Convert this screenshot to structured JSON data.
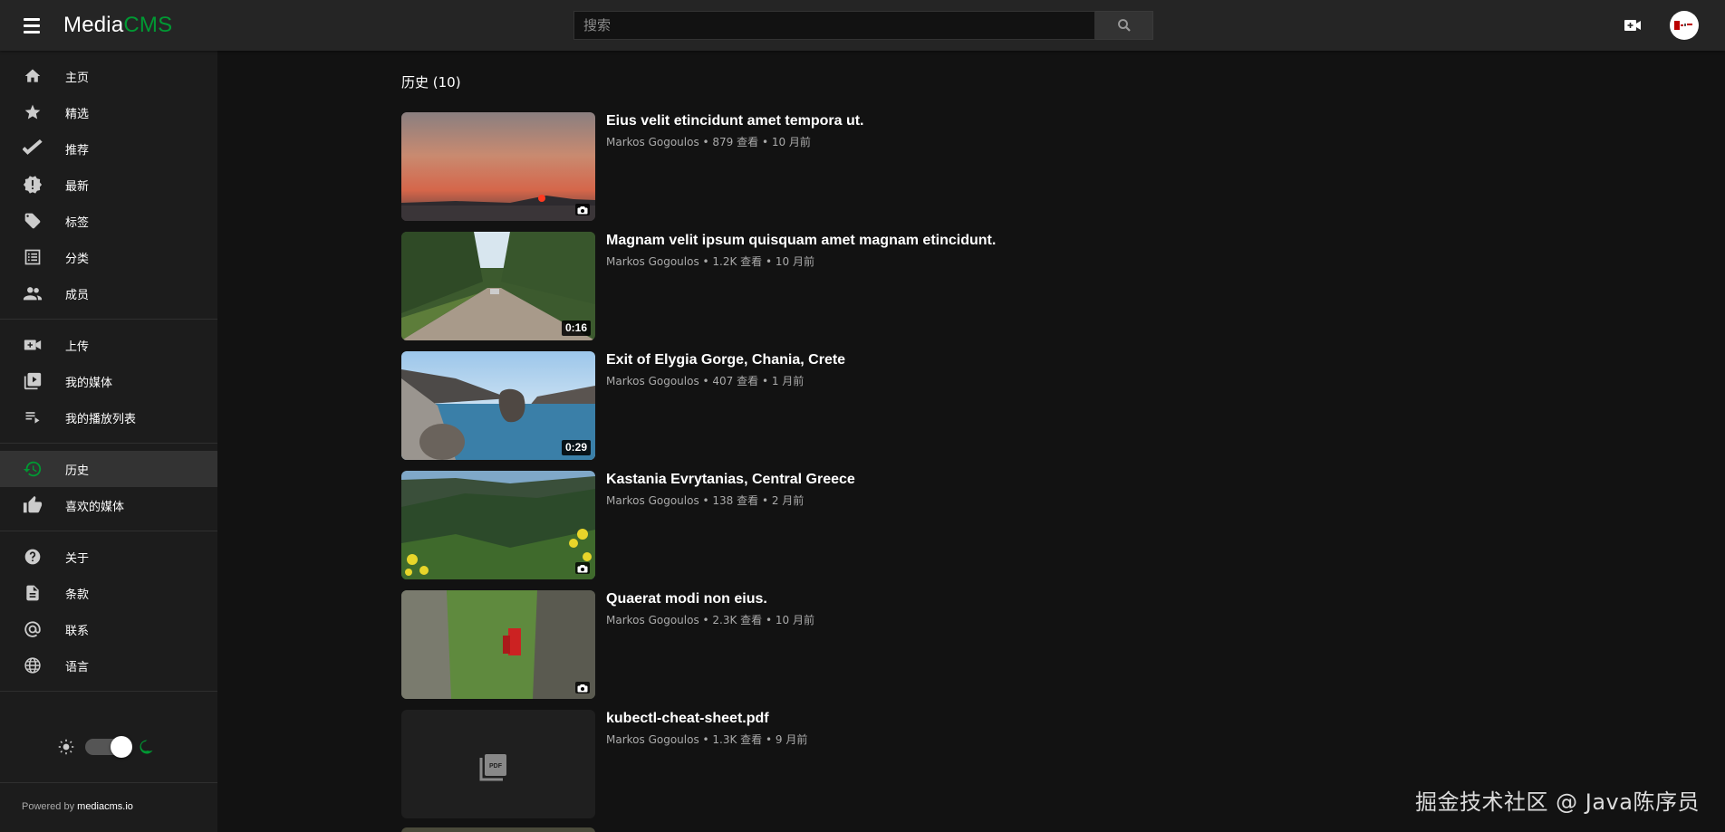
{
  "header": {
    "logo_part1": "Media",
    "logo_part2": "CMS",
    "search_placeholder": "搜索",
    "brand_color": "#009933"
  },
  "sidebar": {
    "groups": [
      [
        {
          "label": "主页",
          "icon": "home-icon"
        },
        {
          "label": "精选",
          "icon": "star-icon"
        },
        {
          "label": "推荐",
          "icon": "check-icon"
        },
        {
          "label": "最新",
          "icon": "new-releases-icon"
        },
        {
          "label": "标签",
          "icon": "tag-icon"
        },
        {
          "label": "分类",
          "icon": "list-icon"
        },
        {
          "label": "成员",
          "icon": "people-icon"
        }
      ],
      [
        {
          "label": "上传",
          "icon": "video-call-icon"
        },
        {
          "label": "我的媒体",
          "icon": "video-library-icon"
        },
        {
          "label": "我的播放列表",
          "icon": "playlist-icon"
        }
      ],
      [
        {
          "label": "历史",
          "icon": "history-icon",
          "active": true
        },
        {
          "label": "喜欢的媒体",
          "icon": "thumb-up-icon"
        }
      ],
      [
        {
          "label": "关于",
          "icon": "help-icon"
        },
        {
          "label": "条款",
          "icon": "document-icon"
        },
        {
          "label": "联系",
          "icon": "at-icon"
        },
        {
          "label": "语言",
          "icon": "globe-icon"
        }
      ]
    ],
    "theme": "dark",
    "footer_prefix": "Powered by ",
    "footer_link": "mediacms.io"
  },
  "main": {
    "title": "历史 (10)",
    "items": [
      {
        "title": "Eius velit etincidunt amet tempora ut.",
        "meta": "Markos Gogoulos • 879 查看 • 10 月前",
        "type": "image",
        "thumb": "sunset"
      },
      {
        "title": "Magnam velit ipsum quisquam amet magnam etincidunt.",
        "meta": "Markos Gogoulos • 1.2K 查看 • 10 月前",
        "type": "video",
        "duration": "0:16",
        "thumb": "forest-road"
      },
      {
        "title": "Exit of Elygia Gorge, Chania, Crete",
        "meta": "Markos Gogoulos • 407 查看 • 1 月前",
        "type": "video",
        "duration": "0:29",
        "thumb": "sea-rocks"
      },
      {
        "title": "Kastania Evrytanias, Central Greece",
        "meta": "Markos Gogoulos • 138 查看 • 2 月前",
        "type": "image",
        "thumb": "mountains"
      },
      {
        "title": "Quaerat modi non eius.",
        "meta": "Markos Gogoulos • 2.3K 查看 • 10 月前",
        "type": "image",
        "thumb": "gorge"
      },
      {
        "title": "kubectl-cheat-sheet.pdf",
        "meta": "Markos Gogoulos • 1.3K 查看 • 9 月前",
        "type": "pdf",
        "thumb": "pdf"
      }
    ]
  },
  "watermark": "掘金技术社区 @ Java陈序员"
}
